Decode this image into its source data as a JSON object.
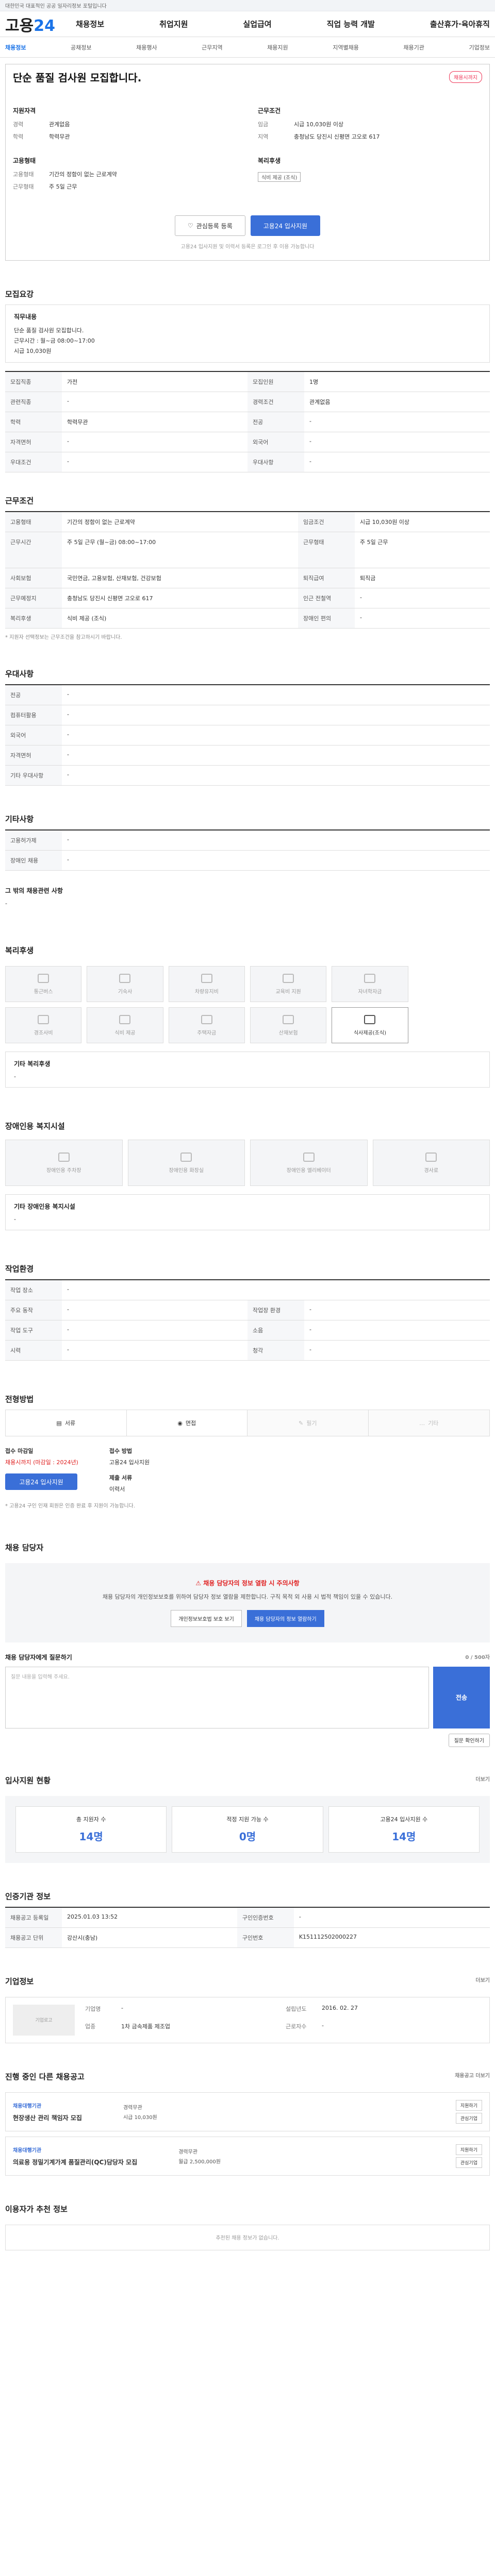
{
  "topbar": {
    "text": "대한민국 대표적인 공공 일자리정보 포털입니다"
  },
  "gnb": {
    "logo_a": "고용",
    "logo_b": "24",
    "menu": [
      "채용정보",
      "취업지원",
      "실업급여",
      "직업 능력 개발",
      "출산휴가·육아휴직"
    ]
  },
  "lnb": {
    "items": [
      "채용정보",
      "공채정보",
      "채용행사",
      "근무지역",
      "채용지원",
      "지역별채용",
      "채용기관",
      "기업정보"
    ]
  },
  "header": {
    "title": "단순 품질 검사원 모집합니다.",
    "badge": "채용시까지",
    "sub": "",
    "req_h": "지원자격",
    "career_k": "경력",
    "career_v": "관계없음",
    "edu_k": "학력",
    "edu_v": "학력무관",
    "cond_h": "근무조건",
    "pay_k": "임금",
    "pay_v": "시급 10,030원 이상",
    "loc_k": "지역",
    "loc_v": "충청남도 당진시 신평면 고오로 617",
    "emp_h": "고용형태",
    "emp_k": "고용형태",
    "emp_v": "기간의 정함이 없는 근로계약",
    "time_k": "근무형태",
    "time_v": "주 5일 근무",
    "benefit_h": "복리후생",
    "benefit_tag": "식비 제공 (조식)",
    "btn_fav": "관심등록 등록",
    "btn_apply": "고용24 입사지원",
    "note": "고용24 입사지원 및 이력서 등록은 로그인 후 이용 가능합니다"
  },
  "recruit": {
    "h": "모집요강",
    "job_h": "직무내용",
    "job_v": "단순 품질 검사원 모집합니다.",
    "job_v2": "근무시간 : 월~금 08:00~17:00",
    "job_v3": "시급 10,030원",
    "rows": [
      [
        "모집직종",
        "가전",
        "모집인원",
        "1명"
      ],
      [
        "관련직종",
        "-",
        "경력조건",
        "관계없음"
      ],
      [
        "학력",
        "학력무관",
        "전공",
        "-"
      ],
      [
        "자격면허",
        "-",
        "외국어",
        "-"
      ],
      [
        "우대조건",
        "-",
        "우대사항",
        "-"
      ]
    ]
  },
  "cond": {
    "h": "근무조건",
    "rows": [
      [
        "고용형태",
        "기간의 정함이 없는 근로계약",
        "임금조건",
        "시급 10,030원 이상"
      ],
      [
        "근무시간",
        "주 5일 근무 (월~금) 08:00~17:00",
        "근무형태",
        "주 5일 근무"
      ],
      [
        "사회보험",
        "국민연금, 고용보험, 산재보험, 건강보험",
        "퇴직급여",
        "퇴직금"
      ],
      [
        "근무예정지",
        "충청남도 당진시 신평면 고오로 617",
        "인근 전철역",
        "-"
      ],
      [
        "복리후생",
        "식비 제공 (조식)",
        "장애인 편의",
        "-"
      ]
    ],
    "note": "* 지원자 선택정보는 근무조건을 참고하시기 바랍니다."
  },
  "pref": {
    "h": "우대사항",
    "rows": [
      [
        "전공",
        "-"
      ],
      [
        "컴퓨터활용",
        "-"
      ],
      [
        "외국어",
        "-"
      ],
      [
        "자격면허",
        "-"
      ],
      [
        "기타 우대사항",
        "-"
      ]
    ]
  },
  "etc": {
    "h": "기타사항",
    "rows": [
      [
        "고용허가제",
        "-"
      ],
      [
        "장애인 채용",
        "-"
      ]
    ],
    "more": "그 밖의 채용관련 사항"
  },
  "welfare": {
    "h": "복리후생",
    "items": [
      "통근버스",
      "기숙사",
      "차량유지비",
      "교육비 지원",
      "자녀학자금",
      "경조사비",
      "식비 제공",
      "주택자금",
      "산재보험",
      "식사제공(조식)"
    ],
    "extra_h": "기타 복리후생"
  },
  "disabled": {
    "h": "장애인용 복지시설",
    "items": [
      "장애인용 주차장",
      "장애인용 화장실",
      "장애인용 엘리베이터",
      "경사로"
    ],
    "extra_h": "기타 장애인용 복지시설"
  },
  "workenv": {
    "h": "작업환경",
    "rows": [
      [
        "작업 장소",
        "-",
        "",
        ""
      ],
      [
        "주요 동작",
        "-",
        "작업장 환경",
        "-"
      ],
      [
        "작업 도구",
        "-",
        "소음",
        "-"
      ],
      [
        "시력",
        "-",
        "청각",
        "-"
      ]
    ]
  },
  "method": {
    "h": "전형방법",
    "items": [
      "서류",
      "면접",
      "필기",
      "기타"
    ],
    "period_h": "접수 마감일",
    "period_v": "채용시까지 (마감일 : 2024년)",
    "way_h": "접수 방법",
    "way_v": "고용24 입사지원",
    "apply_btn": "고용24 입사지원",
    "doc_h": "제출 서류",
    "doc_v": "이력서",
    "notes": "* 고용24 구인 인재 회원은 인증 완료 후 지원이 가능합니다."
  },
  "manager": {
    "h": "채용 담당자",
    "warn": "채용 담당자의 정보 열람 시 주의사항",
    "warn_sub": "채용 담당자의 개인정보보호를 위하여 담당자 정보 열람을 제한합니다. 구직 목적 외 사용 시 법적 책임이 있을 수 있습니다.",
    "btn1": "개인정보보호법 보호 보기",
    "btn2": "채용 담당자의 정보 열람하기",
    "q_h": "채용 담당자에게 질문하기",
    "q_count": "0 / 500자",
    "q_ph": "질문 내용을 입력해 주세요.",
    "q_btn": "전송",
    "q_more": "질문 확인하기"
  },
  "stats": {
    "h": "입사지원 현황",
    "more": "더보기",
    "items": [
      [
        "총 지원자 수",
        "14명"
      ],
      [
        "적정 지원 가능 수",
        "0명"
      ],
      [
        "고용24 입사지원 수",
        "14명"
      ]
    ]
  },
  "info": {
    "h": "인증기관 정보",
    "rows": [
      [
        "채용공고 등록일",
        "2025.01.03 13:52",
        "구인인증번호",
        "-"
      ],
      [
        "채용공고 단위",
        "강산시(충남)",
        "구인번호",
        "K151112502000227"
      ]
    ]
  },
  "company": {
    "h": "기업정보",
    "more": "더보기",
    "name_k": "기업명",
    "name_v": "-",
    "size_k": "업종",
    "size_v": "1차 금속제품 제조업",
    "emp_k": "근로자수",
    "emp_v": "-",
    "year_k": "설립년도",
    "year_v": "2016. 02. 27",
    "logo": "기업로고"
  },
  "related": {
    "h": "진행 중인 다른 채용공고",
    "more": "채용공고 더보기",
    "items": [
      {
        "co": "채용대행기관",
        "title": "현장생산 관리 책임자 모집",
        "r1": "경력무관",
        "r2": "시급 10,030원"
      },
      {
        "co": "채용대행기관",
        "title": "의료용 정밀기계가계 품질관리(QC)담당자 모집",
        "r1": "경력무관",
        "r2": "월급 2,500,000원"
      }
    ],
    "btn1": "지원하기",
    "btn2": "관심기업"
  },
  "footer": {
    "h": "이용자가 추천 정보",
    "empty": "추천된 채용 정보가 없습니다."
  }
}
